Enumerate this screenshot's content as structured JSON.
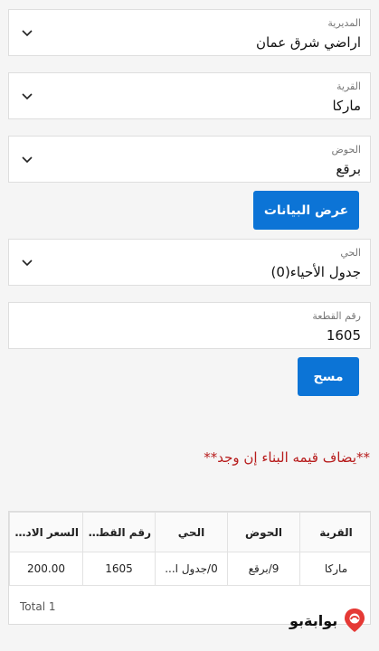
{
  "filters": {
    "directorate": {
      "label": "المديرية",
      "value": "اراضي شرق عمان"
    },
    "village": {
      "label": "القرية",
      "value": "ماركا"
    },
    "basin": {
      "label": "الحوض",
      "value": "برقع"
    },
    "neighborhood": {
      "label": "الحي",
      "value": "جدول الأحياء(0)"
    },
    "plot_number": {
      "label": "رقم القطعة",
      "value": "1605"
    }
  },
  "buttons": {
    "show_data": "عرض البيانات",
    "clear": "مسح"
  },
  "note": "**يضاف قيمه البناء إن وجد**",
  "table": {
    "columns": [
      "القرية",
      "الحوض",
      "الحي",
      "رقم القطعة",
      "السعر الادا..."
    ],
    "rows": [
      [
        "ماركا",
        "9/برقع",
        "0/جدول ا...",
        "1605",
        "200.00"
      ]
    ],
    "total": "Total 1"
  },
  "brand": {
    "name": "بوابةبو"
  }
}
